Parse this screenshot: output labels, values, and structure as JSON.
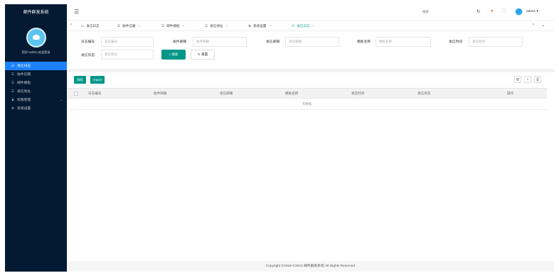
{
  "sidebar": {
    "title": "邮件群发系统",
    "welcome": "您好! admin,欢迎登录",
    "items": [
      {
        "label": "发信日志",
        "icon": "list-icon",
        "active": true
      },
      {
        "label": "收件信箱",
        "icon": "list-icon"
      },
      {
        "label": "邮件模板",
        "icon": "list-icon"
      },
      {
        "label": "发信地址",
        "icon": "list-icon"
      },
      {
        "label": "权限管理",
        "icon": "users-icon",
        "has_caret": true
      },
      {
        "label": "系统设置",
        "icon": "gear-icon"
      }
    ]
  },
  "topbar": {
    "search_label": "搜索",
    "username": "admin"
  },
  "tabs": [
    {
      "label": "发信日志",
      "icon": "monitor-icon"
    },
    {
      "label": "收件信箱",
      "icon": "list-icon"
    },
    {
      "label": "邮件模板",
      "icon": "list-icon"
    },
    {
      "label": "发信地址",
      "icon": "list-icon"
    },
    {
      "label": "系统设置",
      "icon": "gear-icon"
    },
    {
      "label": "发信日志",
      "icon": "list-icon",
      "active": true
    }
  ],
  "filter": {
    "log_no": {
      "label": "日志编号",
      "placeholder": "日志编号"
    },
    "to_mail": {
      "label": "收件邮箱",
      "placeholder": "收件邮箱"
    },
    "from_mail": {
      "label": "发信邮箱",
      "placeholder": "发信邮箱"
    },
    "template": {
      "label": "模板名称",
      "placeholder": "模板名称"
    },
    "send_time": {
      "label": "发信时间",
      "placeholder": "发信时间"
    },
    "status": {
      "label": "发信状态",
      "placeholder": "发信状态"
    },
    "search_label": "搜索",
    "reset_label": "重置"
  },
  "toolbar": {
    "add_label": "添加",
    "import_label": "Import"
  },
  "table": {
    "columns": [
      "日志编号",
      "收件邮箱",
      "发信邮箱",
      "模板名称",
      "发信时间",
      "发信状态",
      "操作"
    ],
    "empty_text": "无数据"
  },
  "footer": {
    "text": "Copyright ©2019-©2021 邮件群发系统 All Rights Reserved"
  },
  "colors": {
    "sidebar_bg": "#041a33",
    "active_blue": "#1e82ff",
    "primary_teal": "#009688"
  }
}
